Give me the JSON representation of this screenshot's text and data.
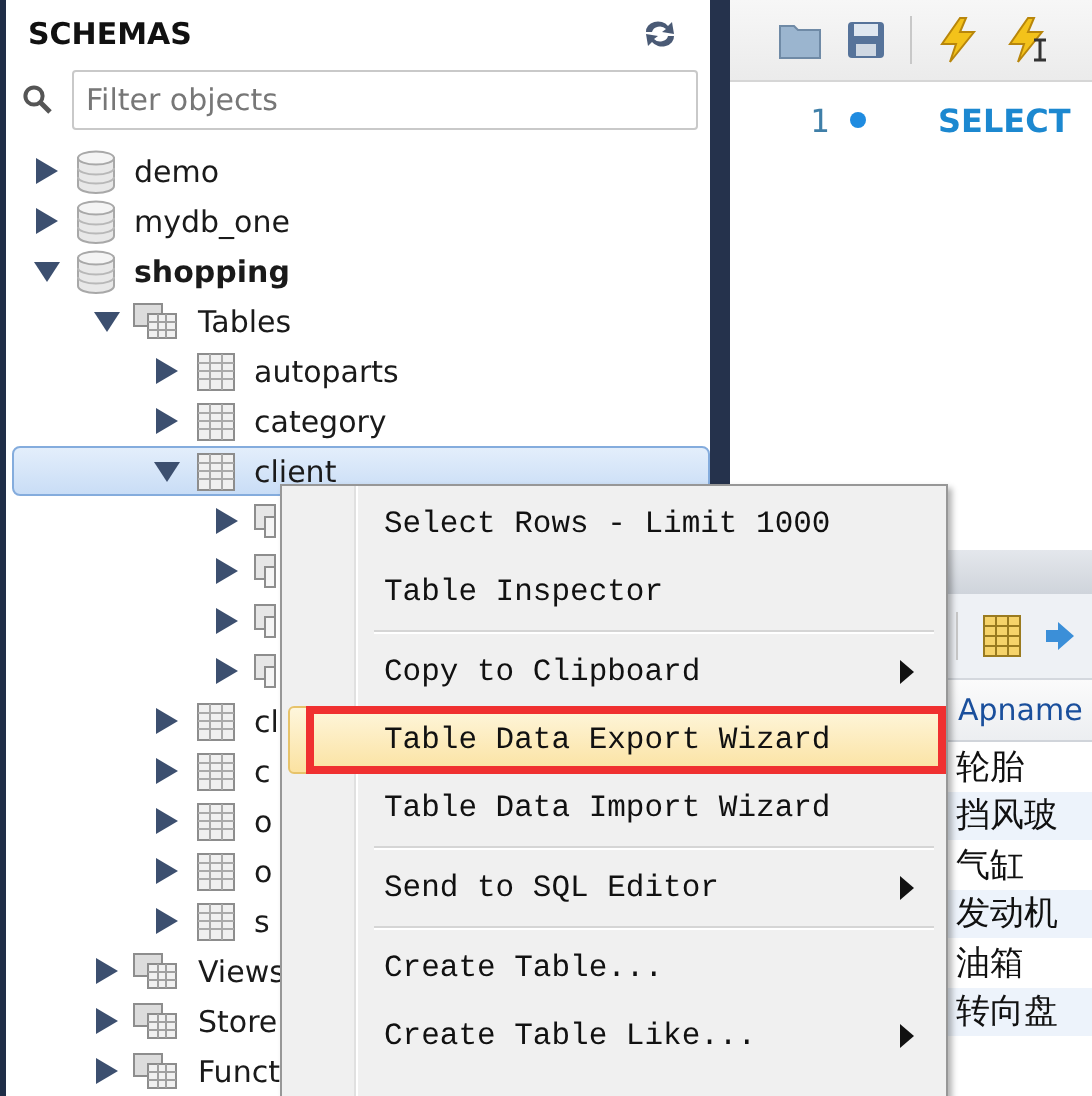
{
  "sidebar": {
    "title": "SCHEMAS",
    "filter": {
      "placeholder": "Filter objects"
    },
    "tree": [
      {
        "label": "demo",
        "kind": "schema",
        "default": false,
        "expanded": false,
        "selected": false
      },
      {
        "label": "mydb_one",
        "kind": "schema",
        "default": false,
        "expanded": false,
        "selected": false
      },
      {
        "label": "shopping",
        "kind": "schema",
        "default": true,
        "expanded": true,
        "selected": false,
        "children": [
          {
            "label": "Tables",
            "kind": "group",
            "expanded": true,
            "selected": false,
            "children": [
              {
                "label": "autoparts",
                "kind": "table",
                "expanded": false,
                "selected": false
              },
              {
                "label": "category",
                "kind": "table",
                "expanded": false,
                "selected": false
              },
              {
                "label": "client",
                "kind": "table",
                "expanded": true,
                "selected": true,
                "children": [
                  {
                    "kind": "folder",
                    "expanded": false,
                    "selected": false
                  },
                  {
                    "kind": "folder",
                    "expanded": false,
                    "selected": false
                  },
                  {
                    "kind": "folder",
                    "expanded": false,
                    "selected": false
                  },
                  {
                    "kind": "folder",
                    "expanded": false,
                    "selected": false
                  }
                ]
              },
              {
                "label": "cl",
                "kind": "table",
                "expanded": false,
                "selected": false
              },
              {
                "label": "c",
                "kind": "table",
                "expanded": false,
                "selected": false
              },
              {
                "label": "o",
                "kind": "table",
                "expanded": false,
                "selected": false
              },
              {
                "label": "o",
                "kind": "table",
                "expanded": false,
                "selected": false
              },
              {
                "label": "s",
                "kind": "table",
                "expanded": false,
                "selected": false
              }
            ]
          },
          {
            "label": "Views",
            "kind": "group",
            "expanded": false,
            "selected": false
          },
          {
            "label": "Store",
            "kind": "group",
            "expanded": false,
            "selected": false
          },
          {
            "label": "Funct",
            "kind": "group",
            "expanded": false,
            "selected": false
          }
        ]
      }
    ]
  },
  "editor": {
    "lines": [
      {
        "number": "1",
        "code": "SELECT"
      }
    ]
  },
  "results": {
    "columns": [
      "Apname"
    ],
    "rows": [
      "轮胎",
      "挡风玻",
      "气缸",
      "发动机",
      "油箱",
      "转向盘"
    ]
  },
  "context_menu": [
    {
      "kind": "item",
      "label": "Select Rows - Limit 1000",
      "submenu": false,
      "selected": false,
      "annotated": false
    },
    {
      "kind": "item",
      "label": "Table Inspector",
      "submenu": false,
      "selected": false,
      "annotated": false
    },
    {
      "kind": "separator"
    },
    {
      "kind": "item",
      "label": "Copy to Clipboard",
      "submenu": true,
      "selected": false,
      "annotated": false
    },
    {
      "kind": "item",
      "label": "Table Data Export Wizard",
      "submenu": false,
      "selected": true,
      "annotated": true
    },
    {
      "kind": "item",
      "label": "Table Data Import Wizard",
      "submenu": false,
      "selected": false,
      "annotated": false
    },
    {
      "kind": "separator"
    },
    {
      "kind": "item",
      "label": "Send to SQL Editor",
      "submenu": true,
      "selected": false,
      "annotated": false
    },
    {
      "kind": "separator"
    },
    {
      "kind": "item",
      "label": "Create Table...",
      "submenu": false,
      "selected": false,
      "annotated": false
    },
    {
      "kind": "item",
      "label": "Create Table Like...",
      "submenu": true,
      "selected": false,
      "annotated": false
    }
  ]
}
